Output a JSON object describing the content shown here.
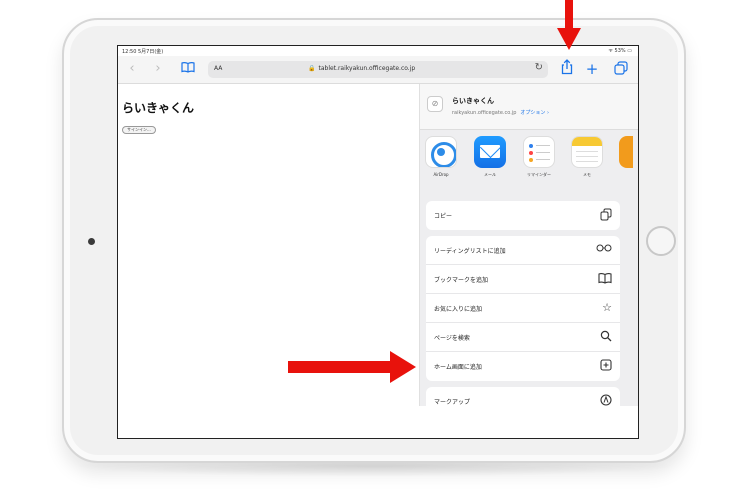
{
  "statusbar": {
    "time": "12:50 5月7日(金)",
    "battery": "ᯤ 53% ▭"
  },
  "toolbar": {
    "aa_label": "AA",
    "url": "tablet.raikyakun.officegate.co.jp"
  },
  "page": {
    "title": "らいきゃくん",
    "button_label": "サインイン..."
  },
  "share_sheet": {
    "title": "らいきゃくん",
    "url": "raikyakun.officegate.co.jp",
    "options_label": "オプション ›",
    "apps": [
      {
        "label": "AirDrop",
        "icon": "airdrop-icon"
      },
      {
        "label": "メール",
        "icon": "mail-icon"
      },
      {
        "label": "リマインダー",
        "icon": "reminders-icon"
      },
      {
        "label": "メモ",
        "icon": "notes-icon"
      }
    ],
    "copy_group": [
      {
        "label": "コピー",
        "icon": "copy-icon"
      }
    ],
    "actions": [
      {
        "label": "リーディングリストに追加",
        "icon": "glasses-icon"
      },
      {
        "label": "ブックマークを追加",
        "icon": "book-icon"
      },
      {
        "label": "お気に入りに追加",
        "icon": "star-icon"
      },
      {
        "label": "ページを検索",
        "icon": "search-icon"
      },
      {
        "label": "ホーム画面に追加",
        "icon": "add-square-icon"
      }
    ],
    "markup_group": [
      {
        "label": "マークアップ",
        "icon": "markup-icon"
      }
    ]
  },
  "colors": {
    "accent": "#1a73e8",
    "annotation_arrow": "#e8120c"
  }
}
